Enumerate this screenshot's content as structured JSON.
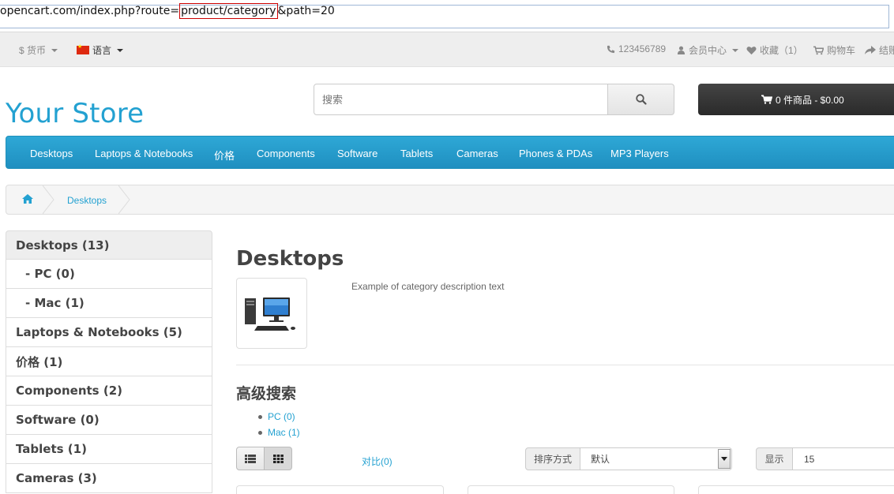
{
  "url": {
    "prefix": "opencart.com/index.php?route=",
    "highlight": "product/category",
    "suffix": "&path=20"
  },
  "topbar": {
    "currency": "$ 货币",
    "language": "语言",
    "phone": "123456789",
    "account": "会员中心",
    "wishlist": "收藏（1）",
    "cart": "购物车",
    "checkout": "结账"
  },
  "header": {
    "logo": "Your Store",
    "search_placeholder": "搜索",
    "cart_button": "0 件商品 - $0.00"
  },
  "menu": {
    "items": [
      "Desktops",
      "Laptops & Notebooks",
      "价格",
      "Components",
      "Software",
      "Tablets",
      "Cameras",
      "Phones & PDAs",
      "MP3 Players"
    ]
  },
  "breadcrumb": {
    "current": "Desktops"
  },
  "sidebar": {
    "items": [
      {
        "label": "Desktops (13)",
        "active": true,
        "sub": false
      },
      {
        "label": "- PC (0)",
        "active": false,
        "sub": true
      },
      {
        "label": "- Mac (1)",
        "active": false,
        "sub": true
      },
      {
        "label": "Laptops & Notebooks (5)",
        "active": false,
        "sub": false
      },
      {
        "label": "价格 (1)",
        "active": false,
        "sub": false
      },
      {
        "label": "Components (2)",
        "active": false,
        "sub": false
      },
      {
        "label": "Software (0)",
        "active": false,
        "sub": false
      },
      {
        "label": "Tablets (1)",
        "active": false,
        "sub": false
      },
      {
        "label": "Cameras (3)",
        "active": false,
        "sub": false
      }
    ]
  },
  "main": {
    "title": "Desktops",
    "description": "Example of category description text",
    "refine_title": "高级搜索",
    "refine_links": [
      "PC (0)",
      "Mac (1)"
    ],
    "compare": "对比(0)",
    "sort_label": "排序方式",
    "sort_value": "默认",
    "show_label": "显示",
    "show_value": "15"
  },
  "colors": {
    "accent": "#23a1d1",
    "menu_bg": "#229ac8",
    "cart_bg": "#363636"
  }
}
